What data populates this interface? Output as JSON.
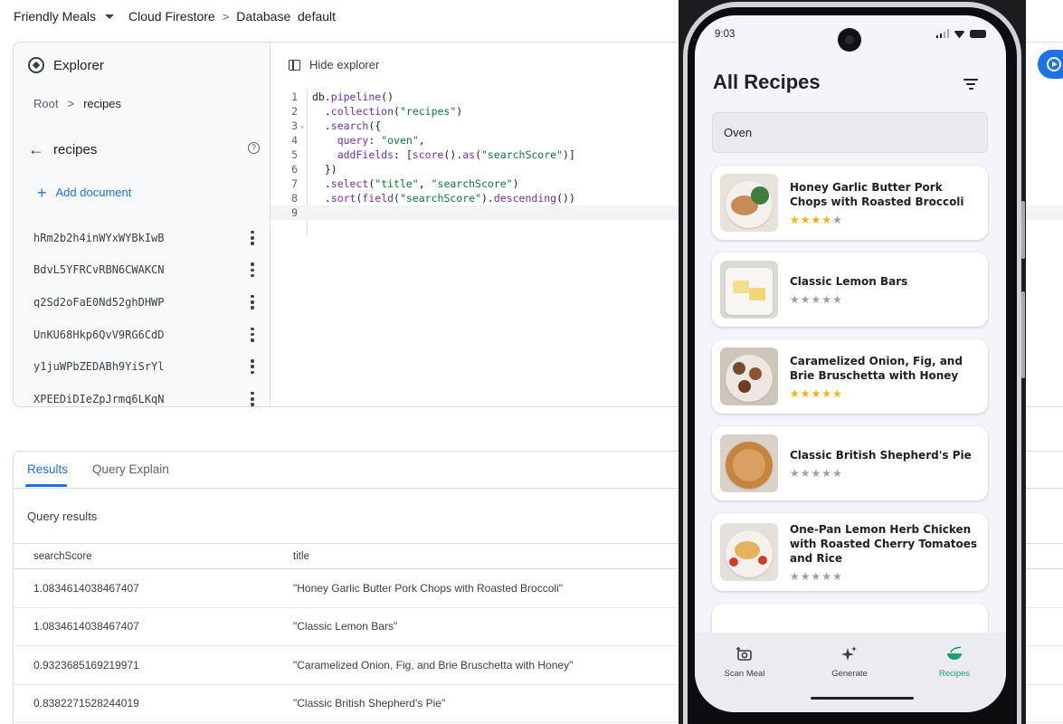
{
  "console": {
    "project": "Friendly Meals",
    "breadcrumb": [
      "Cloud Firestore",
      "Database  default"
    ],
    "explorer": {
      "title": "Explorer",
      "path_root": "Root",
      "path_current": "recipes",
      "collection": "recipes",
      "add_document": "Add document",
      "documents": [
        "hRm2b2h4inWYxWYBkIwB",
        "BdvL5YFRCvRBN6CWAKCN",
        "q2Sd2oFaE0Nd52ghDHWP",
        "UnKU68Hkp6QvV9RG6CdD",
        "y1juWPbZEDABh9YiSrYl",
        "XPEEDiDIeZpJrmq6LKqN"
      ]
    },
    "editor": {
      "hide_explorer": "Hide explorer",
      "line_numbers": [
        "1",
        "2",
        "3",
        "4",
        "5",
        "6",
        "7",
        "8",
        "9"
      ],
      "code_lines": [
        "db.pipeline()",
        "  .collection(\"recipes\")",
        "  .search({",
        "    query: \"oven\",",
        "    addFields: [score().as(\"searchScore\")]",
        "  })",
        "  .select(\"title\", \"searchScore\")",
        "  .sort(field(\"searchScore\").descending())",
        ""
      ]
    },
    "results": {
      "tabs": [
        "Results",
        "Query Explain"
      ],
      "section_label": "Query results",
      "columns": [
        "searchScore",
        "title"
      ],
      "rows": [
        [
          "1.0834614038467407",
          "\"Honey Garlic Butter Pork Chops with Roasted Broccoli\""
        ],
        [
          "1.0834614038467407",
          "\"Classic Lemon Bars\""
        ],
        [
          "0.9323685169219971",
          "\"Caramelized Onion, Fig, and Brie Bruschetta with Honey\""
        ],
        [
          "0.8382271528244019",
          "\"Classic British Shepherd's Pie\""
        ]
      ]
    }
  },
  "phone": {
    "time": "9:03",
    "title": "All Recipes",
    "search_value": "Oven",
    "recipes": [
      {
        "title": "Honey Garlic Butter Pork Chops with Roasted Broccoli",
        "rating": 4
      },
      {
        "title": "Classic Lemon Bars",
        "rating": 0
      },
      {
        "title": "Caramelized Onion, Fig, and Brie Bruschetta with Honey",
        "rating": 5
      },
      {
        "title": "Classic British Shepherd's Pie",
        "rating": 0
      },
      {
        "title": "One-Pan Lemon Herb Chicken with Roasted Cherry Tomatoes and Rice",
        "rating": 0
      }
    ],
    "nav": [
      {
        "label": "Scan Meal",
        "icon": "camera-plus-icon",
        "active": false
      },
      {
        "label": "Generate",
        "icon": "sparkle-icon",
        "active": false
      },
      {
        "label": "Recipes",
        "icon": "bowl-icon",
        "active": true
      }
    ]
  },
  "colors": {
    "accent": "#1a73e8",
    "star": "#f4b400",
    "nav_active": "#18a36b"
  }
}
